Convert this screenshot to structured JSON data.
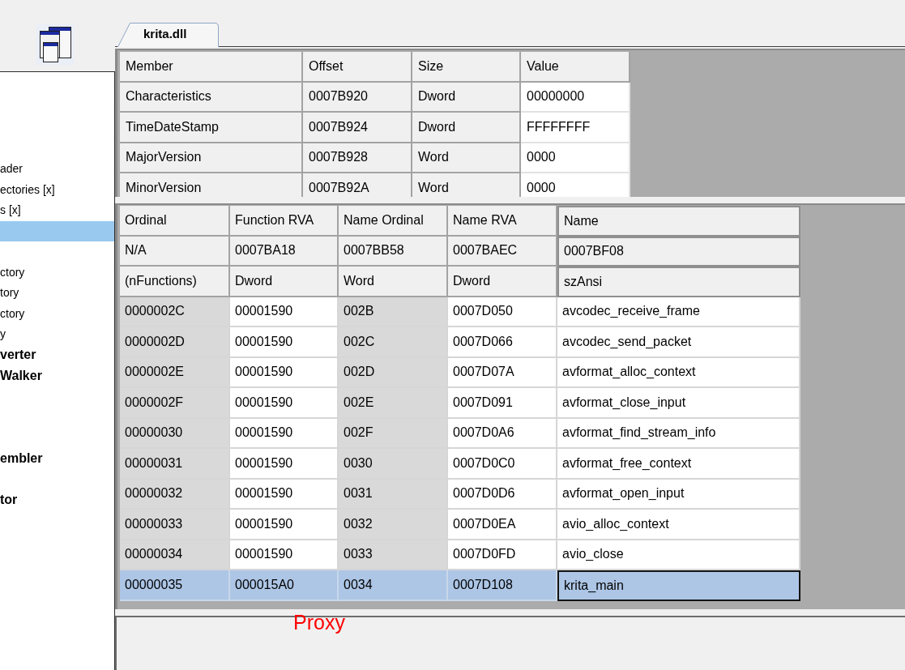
{
  "sidebar": {
    "tree_items": [
      {
        "label": "ader",
        "kind": "node",
        "selected": false
      },
      {
        "label": "ectories [x]",
        "kind": "node",
        "selected": false
      },
      {
        "label": "s [x]",
        "kind": "node",
        "selected": false
      },
      {
        "selected": true
      },
      {
        "selected": false
      },
      {
        "label": "ctory",
        "kind": "node",
        "selected": false
      },
      {
        "label": "tory",
        "kind": "node",
        "selected": false
      },
      {
        "label": "ctory",
        "kind": "node",
        "selected": false
      },
      {
        "label": "y",
        "kind": "node",
        "selected": false
      },
      {
        "label": "verter",
        "kind": "tool",
        "selected": false
      },
      {
        "label": "Walker",
        "kind": "tool",
        "selected": false
      },
      {
        "selected": false
      },
      {
        "selected": false
      },
      {
        "selected": false
      },
      {
        "label": "embler",
        "kind": "tool",
        "selected": false
      },
      {
        "selected": false
      },
      {
        "label": "tor",
        "kind": "tool",
        "selected": false
      }
    ]
  },
  "tabs": [
    {
      "label": "krita.dll",
      "selected": true
    }
  ],
  "header_table": {
    "columns": [
      {
        "label": "Member",
        "read_only": true
      },
      {
        "label": "Offset",
        "read_only": true
      },
      {
        "label": "Size",
        "read_only": true
      },
      {
        "label": "Value",
        "read_only": false
      }
    ],
    "rows": [
      [
        "Characteristics",
        "0007B920",
        "Dword",
        "00000000"
      ],
      [
        "TimeDateStamp",
        "0007B924",
        "Dword",
        "FFFFFFFF"
      ],
      [
        "MajorVersion",
        "0007B928",
        "Word",
        "0000"
      ],
      [
        "MinorVersion",
        "0007B92A",
        "Word",
        "0000"
      ]
    ]
  },
  "export_table": {
    "columns": [
      {
        "label": "Ordinal",
        "read_only": true
      },
      {
        "label": "Function RVA",
        "read_only": false
      },
      {
        "label": "Name Ordinal",
        "read_only": true
      },
      {
        "label": "Name RVA",
        "read_only": false
      },
      {
        "label": "Name",
        "read_only": false
      }
    ],
    "header_rows": [
      [
        "N/A",
        "0007BA18",
        "0007BB58",
        "0007BAEC",
        "0007BF08"
      ],
      [
        "(nFunctions)",
        "Dword",
        "Word",
        "Dword",
        "szAnsi"
      ]
    ],
    "rows": [
      {
        "cells": [
          "0000002C",
          "00001590",
          "002B",
          "0007D050",
          "avcodec_receive_frame"
        ],
        "selected": false
      },
      {
        "cells": [
          "0000002D",
          "00001590",
          "002C",
          "0007D066",
          "avcodec_send_packet"
        ],
        "selected": false
      },
      {
        "cells": [
          "0000002E",
          "00001590",
          "002D",
          "0007D07A",
          "avformat_alloc_context"
        ],
        "selected": false
      },
      {
        "cells": [
          "0000002F",
          "00001590",
          "002E",
          "0007D091",
          "avformat_close_input"
        ],
        "selected": false
      },
      {
        "cells": [
          "00000030",
          "00001590",
          "002F",
          "0007D0A6",
          "avformat_find_stream_info"
        ],
        "selected": false
      },
      {
        "cells": [
          "00000031",
          "00001590",
          "0030",
          "0007D0C0",
          "avformat_free_context"
        ],
        "selected": false
      },
      {
        "cells": [
          "00000032",
          "00001590",
          "0031",
          "0007D0D6",
          "avformat_open_input"
        ],
        "selected": false
      },
      {
        "cells": [
          "00000033",
          "00001590",
          "0032",
          "0007D0EA",
          "avio_alloc_context"
        ],
        "selected": false
      },
      {
        "cells": [
          "00000034",
          "00001590",
          "0033",
          "0007D0FD",
          "avio_close"
        ],
        "selected": false
      },
      {
        "cells": [
          "00000035",
          "000015A0",
          "0034",
          "0007D108",
          "krita_main"
        ],
        "selected": true
      }
    ]
  },
  "overlay_label": "Proxy"
}
